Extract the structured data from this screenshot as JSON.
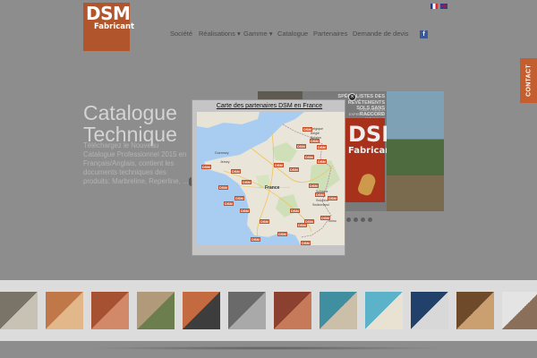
{
  "header": {
    "logo": {
      "line1": "DSM",
      "line2": "Fabricant"
    },
    "languages": [
      {
        "code": "fr",
        "icon": "flag-fr-icon"
      },
      {
        "code": "en",
        "icon": "flag-en-icon"
      }
    ],
    "nav": [
      "Société",
      "Réalisations ▾",
      "Gamme ▾",
      "Catalogue",
      "Partenaires",
      "Demande de devis"
    ],
    "facebook_icon": "f",
    "contact_tab": "CONTACT"
  },
  "hero": {
    "title": "Catalogue\nTechnique",
    "description": "Téléchargez le Nouveau Catalogue Professionnel 2015 en Français/Anglais, contient les documents techniques des produits: Marbreline, Reperline, ...",
    "promo": {
      "tagline": "SPÉCIALISTES DES REVÊTEMENTS SOLS SANS RACCORD",
      "sub": "YOUR FRENCH EXPERT FOR FLOOR AND WALLS COVERINGS",
      "logo_line1": "DSM",
      "logo_line2": "Fabricant"
    },
    "dots_count": 4
  },
  "modal": {
    "title": "Carte des partenaires DSM en France",
    "close_icon": "×",
    "map": {
      "labels": [
        {
          "text": "France",
          "cls": ""
        },
        {
          "text": "Belgique",
          "cls": "small"
        },
        {
          "text": "België",
          "cls": "small"
        },
        {
          "text": "Belgien",
          "cls": "small"
        },
        {
          "text": "Schweiz",
          "cls": "small"
        },
        {
          "text": "Suisse",
          "cls": "small"
        },
        {
          "text": "Svizzera",
          "cls": "small"
        },
        {
          "text": "Switzerland",
          "cls": "small"
        },
        {
          "text": "Guernsey",
          "cls": "small"
        },
        {
          "text": "Jersey",
          "cls": "small"
        },
        {
          "text": "Torino",
          "cls": "small"
        }
      ],
      "pin_label": "DSM",
      "pin_count": 26
    }
  },
  "thumbnails": [
    {
      "name": "stone-sphere-thumb",
      "colors": [
        "#7a7468",
        "#c8c2b4"
      ]
    },
    {
      "name": "terracotta-steps-thumb",
      "colors": [
        "#c07848",
        "#e2b78a"
      ]
    },
    {
      "name": "red-stairs-thumb",
      "colors": [
        "#a65132",
        "#d2896a"
      ]
    },
    {
      "name": "patio-thumb",
      "colors": [
        "#b19a7a",
        "#6c7d4e"
      ]
    },
    {
      "name": "house-facade-thumb",
      "colors": [
        "#c46a40",
        "#3d3d3d"
      ]
    },
    {
      "name": "terrace-furniture-thumb",
      "colors": [
        "#6a6a6a",
        "#a9a9a9"
      ]
    },
    {
      "name": "brick-wall-thumb",
      "colors": [
        "#8c4030",
        "#c67a5a"
      ]
    },
    {
      "name": "pool-edge-thumb",
      "colors": [
        "#3f8fa0",
        "#cbbfa9"
      ]
    },
    {
      "name": "pool-thumb",
      "colors": [
        "#5bb2c9",
        "#e9e2d2"
      ]
    },
    {
      "name": "blue-lounger-thumb",
      "colors": [
        "#22416a",
        "#d8d8d8"
      ]
    },
    {
      "name": "compass-rose-thumb",
      "colors": [
        "#6e4a2a",
        "#caa070"
      ]
    },
    {
      "name": "white-car-thumb",
      "colors": [
        "#e4e4e4",
        "#8a6f5a"
      ]
    }
  ]
}
